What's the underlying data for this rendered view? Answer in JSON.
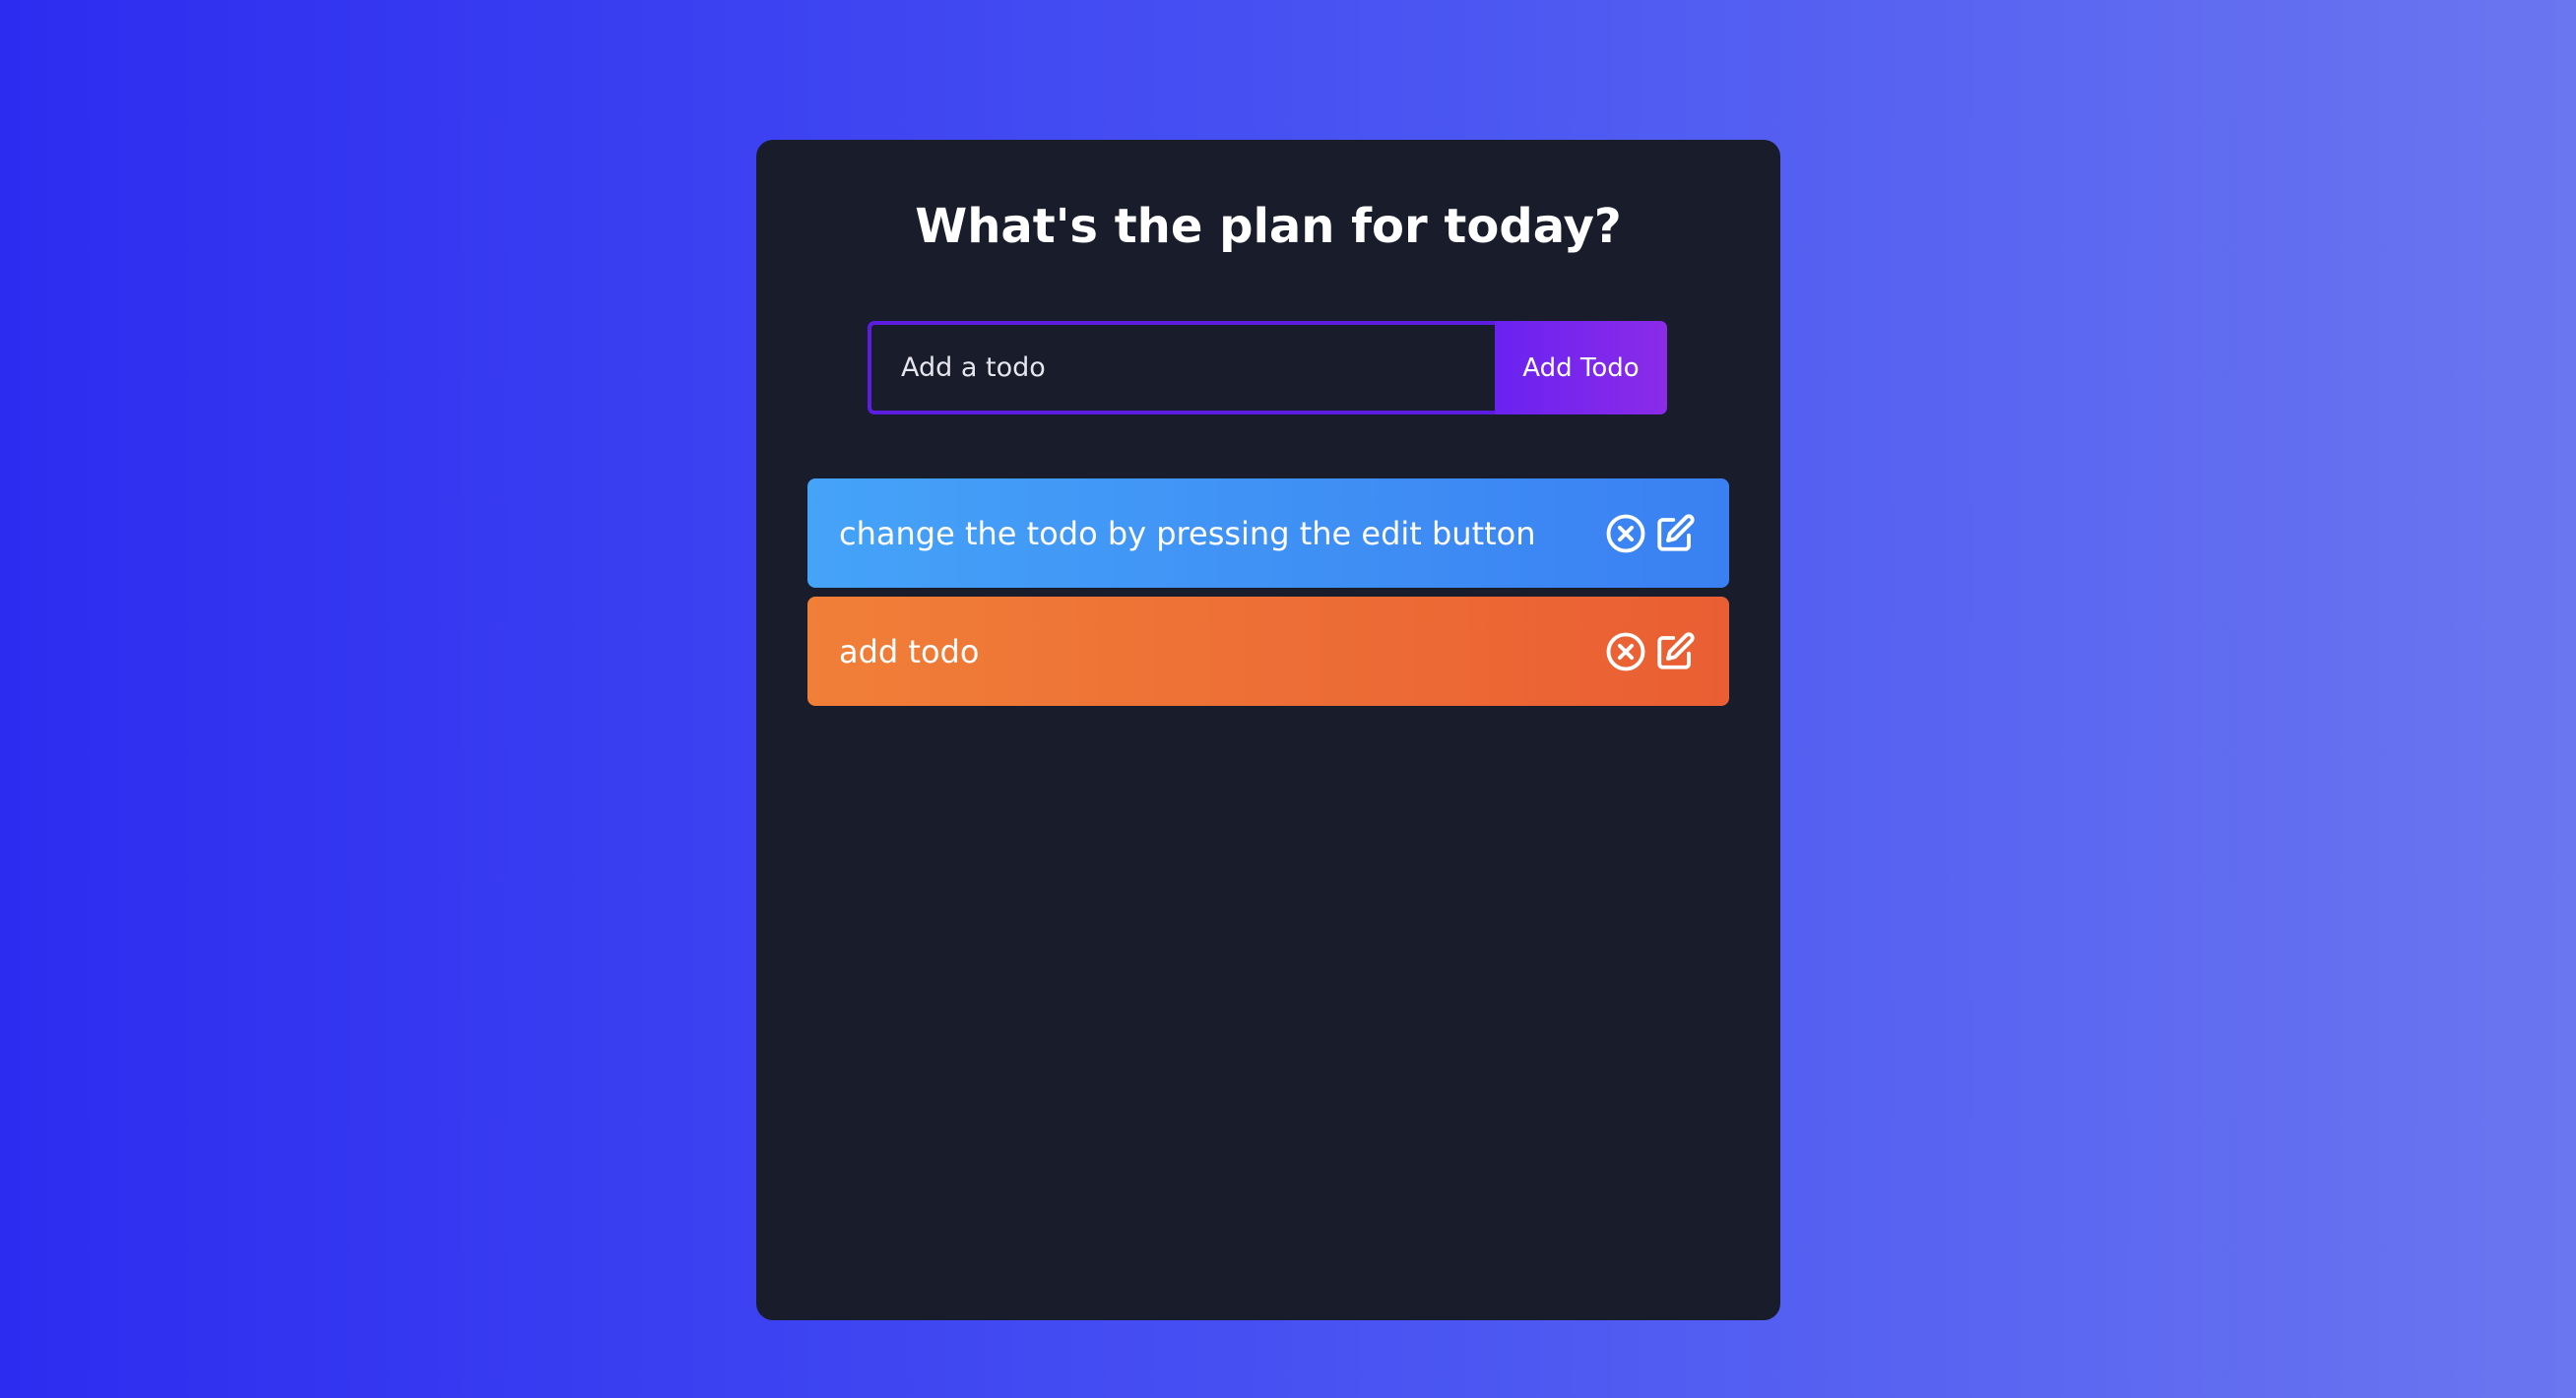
{
  "header": {
    "title": "What's the plan for today?"
  },
  "form": {
    "input_placeholder": "Add a todo",
    "input_value": "",
    "add_button_label": "Add Todo"
  },
  "todos": [
    {
      "text": "change the todo by pressing the edit button",
      "color": "#3a8af4",
      "delete_icon": "circle-x-icon",
      "edit_icon": "edit-icon"
    },
    {
      "text": "add todo",
      "color": "#ee6d35",
      "delete_icon": "circle-x-icon",
      "edit_icon": "edit-icon"
    }
  ],
  "colors": {
    "background_start": "#2c2cf0",
    "background_end": "#6a76f0",
    "card": "#181c2b",
    "accent": "#6a22f0"
  }
}
